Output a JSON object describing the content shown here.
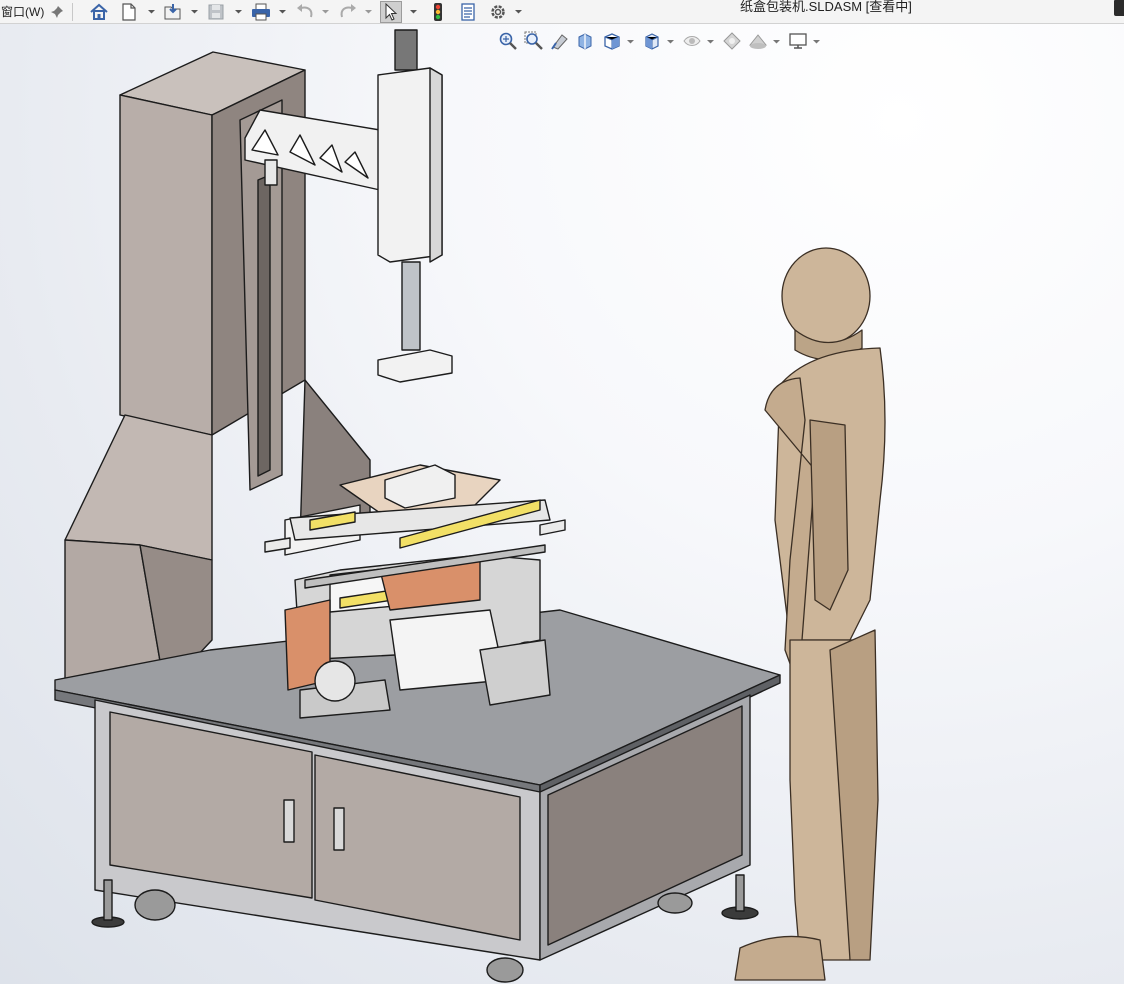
{
  "toolbar": {
    "menu_label": "窗口(W)",
    "document_title": "纸盒包装机.SLDASM [查看中]"
  },
  "toolbar_icons": [
    "pin-icon",
    "home-icon",
    "new-document-icon",
    "open-icon",
    "save-icon",
    "print-icon",
    "undo-icon",
    "redo-icon",
    "select-cursor-icon",
    "rebuild-traffic-light-icon",
    "file-properties-icon",
    "options-gear-icon"
  ],
  "heads_up_icons": [
    "zoom-to-fit-icon",
    "zoom-to-area-icon",
    "previous-view-icon",
    "section-view-icon",
    "view-orientation-icon",
    "display-style-icon",
    "hide-show-items-icon",
    "edit-appearance-icon",
    "apply-scene-icon",
    "view-settings-icon"
  ],
  "colors": {
    "toolbar_bg": "#f4f4f4",
    "machine_panel": "#b6aca7",
    "machine_panel_dark": "#8f8580",
    "table_top": "#9c9ea2",
    "mannequin": "#cdb69a",
    "accent_yellow": "#f2e066",
    "accent_orange": "#d9906a"
  }
}
